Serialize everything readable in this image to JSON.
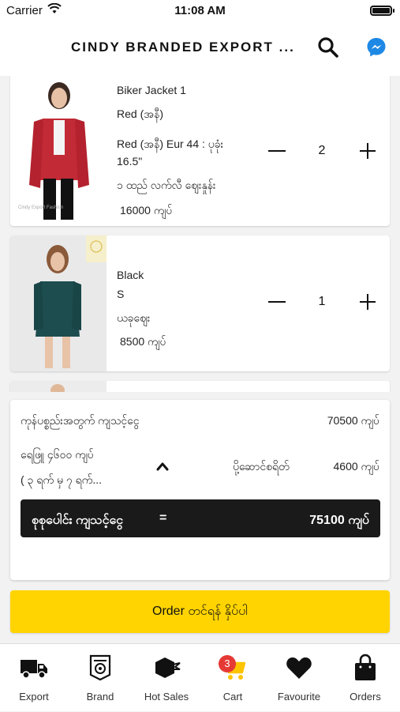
{
  "status": {
    "carrier": "Carrier",
    "time": "11:08 AM"
  },
  "header": {
    "title": "CINDY BRANDED EXPORT ...",
    "search_icon": "search-icon",
    "messenger_icon": "messenger-icon"
  },
  "cart_items": [
    {
      "name": "Biker Jacket 1",
      "color": "Red (အနီ)",
      "size_line1": "Red (အနီ) Eur 44 : ပုခုံး",
      "size_line2": "16.5\"",
      "note": "၁ ထည် လက်လီ ဈေးနှုန်း",
      "price": "16000 ကျပ်",
      "qty": "2",
      "watermark": "Cindy Export Fashion"
    },
    {
      "name": "Black",
      "color": "S",
      "note": "ယခုဈေး",
      "price": "8500 ကျပ်",
      "qty": "1"
    }
  ],
  "summary": {
    "subtotal_label": "ကုန်ပစ္စည်းအတွက် ကျသင့်ငွေ",
    "subtotal_value": "70500 ကျပ်",
    "delivery_line1": "ရေဖြူ ၄၆၀၀ ကျပ်",
    "delivery_line2": "( ၃ ရက် မှ ၇ ရက်...",
    "delivery_fee_label": "ပို့ဆောင်စရိတ်",
    "delivery_fee_value": "4600 ကျပ်",
    "total_label": "စုစုပေါင်း ကျသင့်ငွေ",
    "total_eq": "=",
    "total_value": "75100 ကျပ်"
  },
  "order_button": "Order တင်ရန် နှိပ်ပါ",
  "tabs": [
    {
      "label": "Export",
      "icon": "truck-icon"
    },
    {
      "label": "Brand",
      "icon": "brand-badge-icon"
    },
    {
      "label": "Hot Sales",
      "icon": "hot-sales-icon"
    },
    {
      "label": "Cart",
      "icon": "cart-icon",
      "badge": "3"
    },
    {
      "label": "Favourite",
      "icon": "heart-icon"
    },
    {
      "label": "Orders",
      "icon": "shopping-bag-icon"
    }
  ],
  "colors": {
    "accent": "#ffd400",
    "total_bar": "#1a1a1a",
    "badge": "#e53935",
    "messenger": "#1e88e5"
  }
}
